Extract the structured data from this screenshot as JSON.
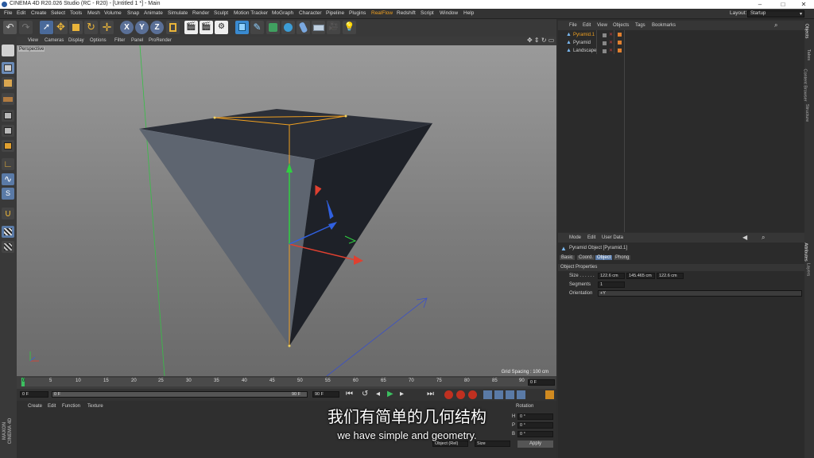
{
  "window": {
    "title": "CINEMA 4D R20.026 Studio (RC - R20) - [Untitled 1 *] - Main",
    "minimize": "–",
    "maximize": "□",
    "close": "✕"
  },
  "menu": [
    "File",
    "Edit",
    "Create",
    "Select",
    "Tools",
    "Mesh",
    "Volume",
    "Snap",
    "Animate",
    "Simulate",
    "Render",
    "Sculpt",
    "Motion Tracker",
    "MoGraph",
    "Character",
    "Pipeline",
    "Plugins",
    "RealFlow",
    "Redshift",
    "Script",
    "Window",
    "Help"
  ],
  "layout": {
    "label": "Layout:",
    "value": "Startup"
  },
  "toolbar_icons": [
    "undo-icon",
    "redo-icon",
    "live-select-icon",
    "move-icon",
    "scale-icon",
    "rotate-icon",
    "create-icon",
    "x-axis-icon",
    "y-axis-icon",
    "z-axis-icon",
    "coordinate-system-icon",
    "render-view-icon",
    "render-picture-viewer-icon",
    "render-settings-icon",
    "cube-icon",
    "pen-icon",
    "subdivision-icon",
    "array-icon",
    "deformer-icon",
    "floor-icon",
    "camera-icon",
    "light-icon"
  ],
  "axis_labels": [
    "X",
    "Y",
    "Z"
  ],
  "viewport": {
    "menu": [
      "View",
      "Cameras",
      "Display",
      "Options",
      "Filter",
      "Panel",
      "ProRender"
    ],
    "label": "Perspective",
    "grid_spacing": "Grid Spacing : 100 cm"
  },
  "timeline": {
    "ticks": [
      "0",
      "5",
      "10",
      "15",
      "20",
      "25",
      "30",
      "35",
      "40",
      "45",
      "50",
      "55",
      "60",
      "65",
      "70",
      "75",
      "80",
      "85",
      "90"
    ],
    "frame_end": "0 F"
  },
  "transport": {
    "start": "0 F",
    "current": "0 F",
    "end": "90 F",
    "end2": "90 F"
  },
  "material_manager": {
    "menu": [
      "Create",
      "Edit",
      "Function",
      "Texture"
    ]
  },
  "coord": {
    "label": "Rotation",
    "rows": [
      {
        "axis": "H",
        "value": "0 °"
      },
      {
        "axis": "P",
        "value": "0 °"
      },
      {
        "axis": "B",
        "value": "0 °"
      }
    ],
    "apply": "Apply",
    "mode_select": "Object (Rel)",
    "size_select": "Size"
  },
  "objects": {
    "menu": [
      "File",
      "Edit",
      "View",
      "Objects",
      "Tags",
      "Bookmarks"
    ],
    "items": [
      {
        "name": "Pyramid.1",
        "selected": true
      },
      {
        "name": "Pyramid",
        "selected": false
      },
      {
        "name": "Landscape",
        "selected": false
      }
    ]
  },
  "attributes": {
    "menu": [
      "Mode",
      "Edit",
      "User Data"
    ],
    "object": "Pyramid Object [Pyramid.1]",
    "tabs": [
      "Basic",
      "Coord.",
      "Object",
      "Phong"
    ],
    "active_tab": "Object",
    "section": "Object Properties",
    "size_label": "Size . . . . . .",
    "size": [
      "122.6 cm",
      "145.465 cm",
      "122.6 cm"
    ],
    "segments_label": "Segments",
    "segments": "1",
    "orientation_label": "Orientation",
    "orientation": "+Y"
  },
  "right_tabs": [
    "Objects",
    "Takes",
    "Content Browser",
    "Structure"
  ],
  "right_tabs2": [
    "Attributes",
    "Layers"
  ],
  "brand": "MAXON CINEMA 4D",
  "subtitles": {
    "cn": "我们有简单的几何结构",
    "en": "we have simple and geometry."
  },
  "colors": {
    "accent": "#f0a020",
    "axis_x": "#e04030",
    "axis_y": "#30d040",
    "axis_z": "#3060e0"
  }
}
